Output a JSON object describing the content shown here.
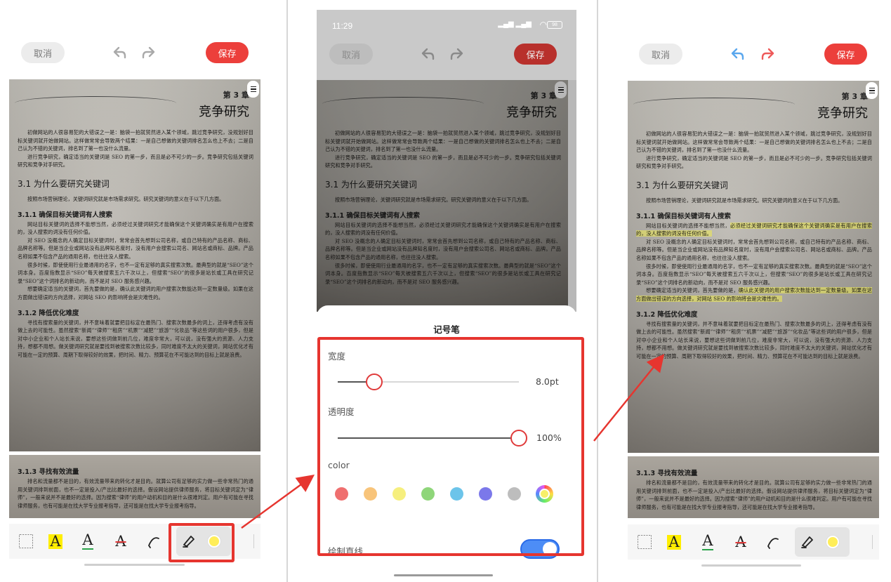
{
  "topbar": {
    "cancel_label": "取消",
    "save_label": "保存"
  },
  "status_bar": {
    "time": "11:29",
    "battery": "98"
  },
  "document": {
    "chapter_label": "第 3 章",
    "chapter_title": "竞争研究",
    "intro_1": "初做网站的人很容易犯的大错误之一是：脑袋一拍就贸然进入某个领域，跳过竞争研究，没规划好目标关键词就开始做网站。这样做常常会导致两个结果：一是自己想做的关键词排名怎么也上不去；二是自己认为不错的关键词，排名到了第一也没什么流量。",
    "intro_2": "进行竞争研究，确定适当的关键词是 SEO 的第一步，而且是必不可少的一步。竞争研究包括关键词研究和竞争对手研究。",
    "section_31": "3.1  为什么要研究关键词",
    "section_31_text": "按照市场营销理论，关键词研究就是市场需求研究。研究关键词的意义在于以下几方面。",
    "section_311": "3.1.1  确保目标关键词有人搜索",
    "section_311_text_1a": "网站目标关键词的选择不能想当然，",
    "section_311_text_1b": "必须经过关键词研究才能确保这个关键词确实是有用户在搜索的，没人搜索的词没有任何价值。",
    "section_311_text_2": "对 SEO 没概念的人确定目标关键词时，常常会首先想到公司名称，或自己特有的产品名称、商标、品牌名称等。但是当企业或网站没有品牌知名度时，没有用户会搜索公司名、网站名或商标、品牌。产品名称如果不包含产品的通用名称，也往往没人搜索。",
    "section_311_text_3": "很多时候，即使使用行业最通用的名字，也不一定有足够的真实搜索次数。最典型的就是“SEO”这个词本身。百度指数显示“SEO”每天被搜索五六千次以上，但搜索“SEO”的很多是站长或工具在研究记录“SEO”这个词排名的新动向，而不是对 SEO 服务感兴趣。",
    "section_311_text_4a": "想要确定适当的关键词，首先要做的是，",
    "section_311_text_4b": "确认此关键词的用户搜索次数能达到一定数量级。如果在这方面做出错误的方向选择，对网站 SEO 的影响将会是灾难性的。",
    "section_312": "3.1.2  降低优化难度",
    "section_312_text": "寻找有搜索量的关键词，并不意味着就要把目标定在最热门、搜索次数最多的词上，还得考虑有没有做上去的可能性。虽然搜索“新闻”“律师”“租房”“机票”“减肥”“旅游”“化妆品”等这些词的用户很多，但是对中小企业和个人站长来说，要想这些词做到前几位，难度非常大，可以说，没有强大的资源、人力支持，想都不用想。做关键词研究就是要找到被搜索次数比较多，同时难度不太大的关键词，网站优化才有可能在一定的预算、周期下取得较好的效果，把时间、精力、预算花在不可能达到的目标上就是浪费。",
    "section_313": "3.1.3  寻找有效流量",
    "section_313_text": "排名和流量都不是目的，有效流量带来的转化才是目的。就算公司有足够的实力做一些非常热门的通用关键词排到前面，也不一定是投入/产出比最好的选择。假设网站提供律师服务，将目标关键词定为“律师”，一般来说并不是最好的选择。因为搜索“律师”的用户动机和目的是什么很难判定。用户有可能在寻找律师服务，也有可能是在找大学专业报考指导，还可能是在找大学专业报考指导。"
  },
  "toolbar": {
    "tools": [
      "select-tool",
      "highlight-text-tool",
      "underline-text-tool",
      "strikethrough-text-tool",
      "pen-tool",
      "highlighter-tool",
      "color-picker"
    ]
  },
  "sheet": {
    "title": "记号笔",
    "width_label": "宽度",
    "width_value": "8.0pt",
    "width_fraction": 0.2,
    "opacity_label": "透明度",
    "opacity_value": "100%",
    "opacity_fraction": 1.0,
    "color_label": "color",
    "colors": [
      "#ef6f6f",
      "#f8c47a",
      "#f6ef7e",
      "#8fd67a",
      "#6cc4ea",
      "#7b78ea",
      "#bdbdbd"
    ],
    "straight_line_label": "绘制直线",
    "straight_line_on": true
  }
}
